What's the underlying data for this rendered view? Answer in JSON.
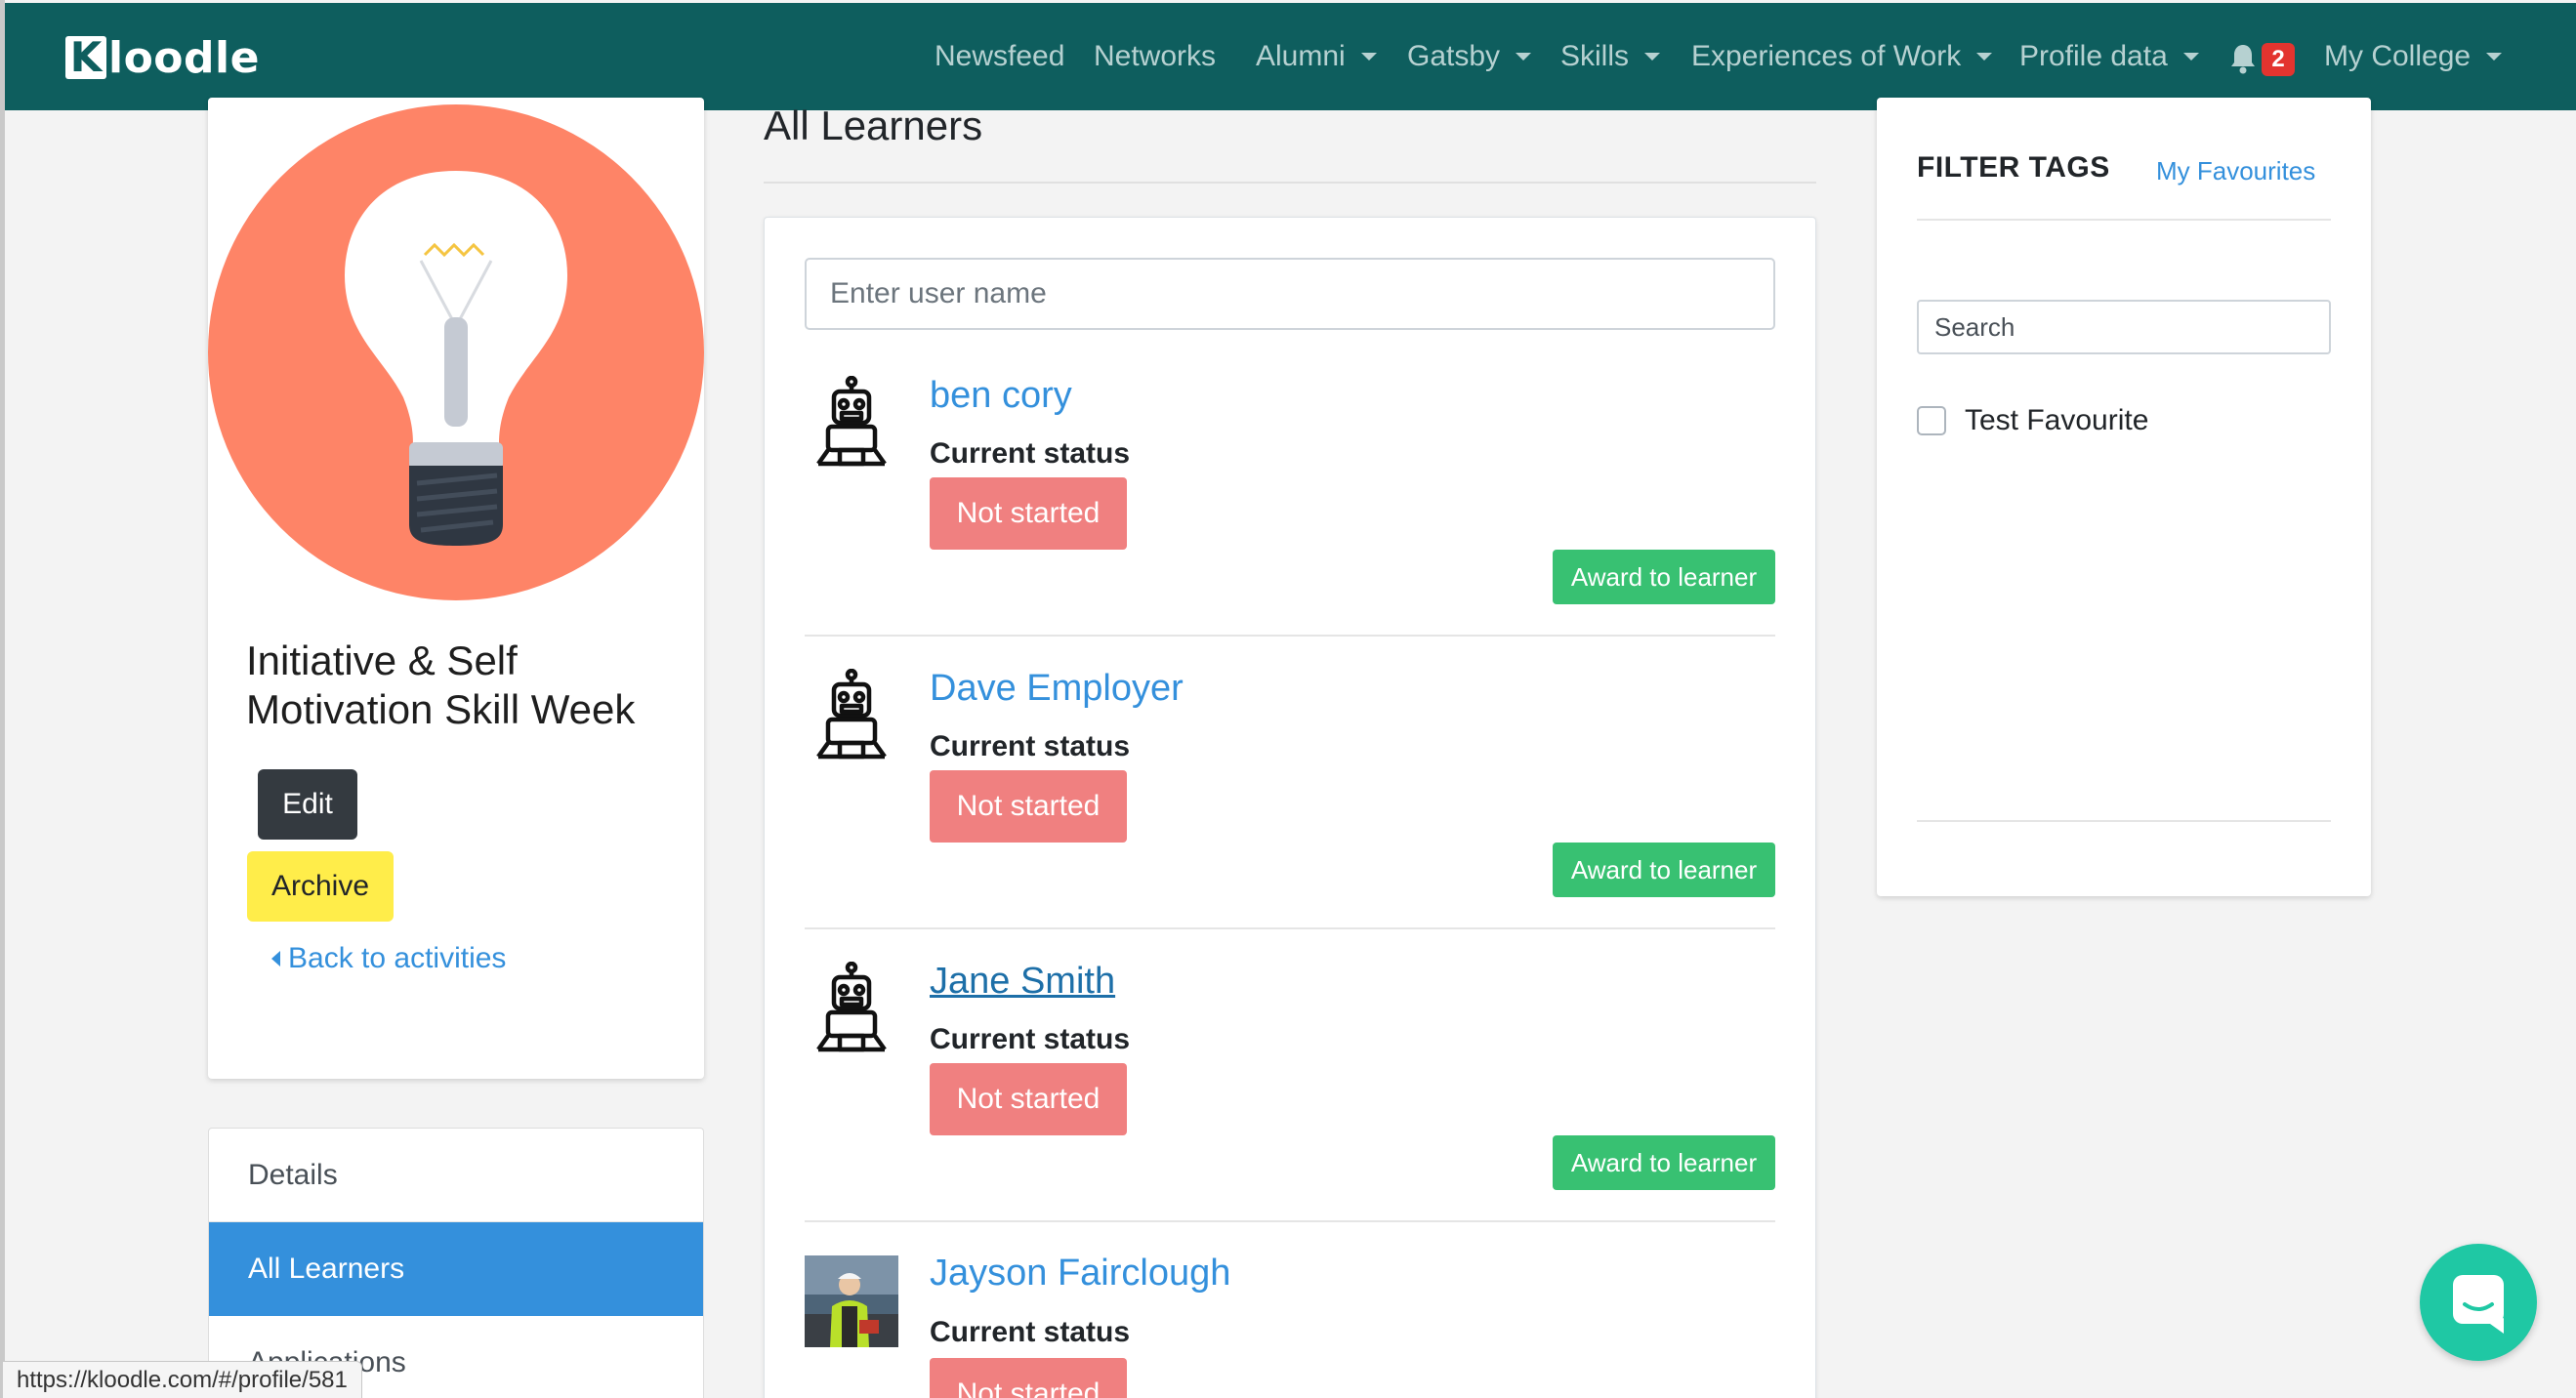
{
  "navbar": {
    "brand_k": "K",
    "brand_rest": "loodle",
    "items": [
      {
        "label": "Newsfeed"
      },
      {
        "label": "Networks"
      },
      {
        "label": "Alumni"
      },
      {
        "label": "Gatsby"
      },
      {
        "label": "Skills"
      },
      {
        "label": "Experiences of Work"
      },
      {
        "label": "Profile data"
      }
    ],
    "notifications": "2",
    "college": "My College"
  },
  "activity": {
    "title": "Initiative & Self Motivation Skill Week",
    "edit_label": "Edit",
    "archive_label": "Archive",
    "back_label": "Back to activities"
  },
  "menu": {
    "details": "Details",
    "learners": "All Learners",
    "applications": "Applications"
  },
  "main": {
    "title": "All Learners",
    "search_placeholder": "Enter user name",
    "learners": [
      {
        "name": "ben cory",
        "status_label": "Current status",
        "status": "Not started",
        "award": "Award to learner"
      },
      {
        "name": "Dave Employer",
        "status_label": "Current status",
        "status": "Not started",
        "award": "Award to learner"
      },
      {
        "name": "Jane Smith",
        "status_label": "Current status",
        "status": "Not started",
        "award": "Award to learner"
      },
      {
        "name": "Jayson Fairclough",
        "status_label": "Current status",
        "status": "Not started"
      }
    ]
  },
  "filter": {
    "title": "FILTER TAGS",
    "favourites_link": "My Favourites",
    "search_placeholder": "Search",
    "tags": [
      {
        "label": "Test Favourite",
        "checked": false
      }
    ]
  },
  "status_bar": {
    "url": "https://kloodle.com/#/profile/581"
  },
  "colors": {
    "navbar": "#0e5e5e",
    "link": "#3490dc",
    "status_badge": "#f08080",
    "award": "#38c172",
    "archive": "#ffed4a",
    "chat": "#1fc8a4"
  }
}
